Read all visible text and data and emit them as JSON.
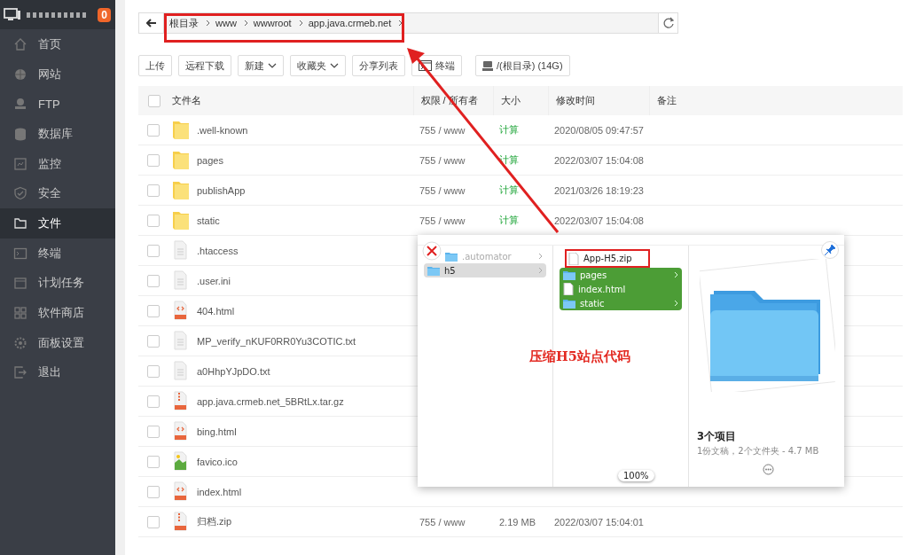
{
  "sidebar": {
    "badge": "0",
    "items": [
      {
        "label": "首页",
        "selected": false
      },
      {
        "label": "网站",
        "selected": false
      },
      {
        "label": "FTP",
        "selected": false
      },
      {
        "label": "数据库",
        "selected": false
      },
      {
        "label": "监控",
        "selected": false
      },
      {
        "label": "安全",
        "selected": false
      },
      {
        "label": "文件",
        "selected": true
      },
      {
        "label": "终端",
        "selected": false
      },
      {
        "label": "计划任务",
        "selected": false
      },
      {
        "label": "软件商店",
        "selected": false
      },
      {
        "label": "面板设置",
        "selected": false
      },
      {
        "label": "退出",
        "selected": false
      }
    ]
  },
  "breadcrumb": [
    "根目录",
    "www",
    "wwwroot",
    "app.java.crmeb.net"
  ],
  "toolbar": [
    {
      "label": "上传",
      "kind": "plain"
    },
    {
      "label": "远程下载",
      "kind": "plain"
    },
    {
      "label": "新建",
      "kind": "dropdown"
    },
    {
      "label": "收藏夹",
      "kind": "dropdown"
    },
    {
      "label": "分享列表",
      "kind": "plain"
    },
    {
      "label": "终端",
      "kind": "terminal"
    },
    {
      "label": "/(根目录) (14G)",
      "kind": "disk"
    }
  ],
  "table": {
    "columns": [
      "文件名",
      "权限 / 所有者",
      "大小",
      "修改时间",
      "备注"
    ],
    "header_checked": false,
    "rows": [
      {
        "name": ".well-known",
        "kind": "folder",
        "checked": false,
        "permissions": "755 / www",
        "size": "计算",
        "size_link": true,
        "modified": "2020/08/05 09:47:57"
      },
      {
        "name": "pages",
        "kind": "folder",
        "checked": false,
        "permissions": "755 / www",
        "size": "计算",
        "size_link": true,
        "modified": "2022/03/07 15:04:08"
      },
      {
        "name": "publishApp",
        "kind": "folder",
        "checked": false,
        "permissions": "755 / www",
        "size": "计算",
        "size_link": true,
        "modified": "2021/03/26 18:19:23"
      },
      {
        "name": "static",
        "kind": "folder",
        "checked": false,
        "permissions": "755 / www",
        "size": "计算",
        "size_link": true,
        "modified": "2022/03/07 15:04:08"
      },
      {
        "name": ".htaccess",
        "kind": "text",
        "checked": false
      },
      {
        "name": ".user.ini",
        "kind": "text",
        "checked": false
      },
      {
        "name": "404.html",
        "kind": "html",
        "checked": false
      },
      {
        "name": "MP_verify_nKUF0RR0Yu3COTIC.txt",
        "kind": "text",
        "checked": false
      },
      {
        "name": "a0HhpYJpDO.txt",
        "kind": "text",
        "checked": false
      },
      {
        "name": "app.java.crmeb.net_5BRtLx.tar.gz",
        "kind": "archive",
        "checked": false
      },
      {
        "name": "bing.html",
        "kind": "html",
        "checked": false
      },
      {
        "name": "favico.ico",
        "kind": "image",
        "checked": false
      },
      {
        "name": "index.html",
        "kind": "html",
        "checked": false
      },
      {
        "name": "归档.zip",
        "kind": "archive",
        "checked": false,
        "permissions": "755 / www",
        "size": "2.19 MB",
        "size_link": false,
        "modified": "2022/03/07 15:04:01"
      }
    ]
  },
  "preview": {
    "columns": [
      [
        {
          "name": ".automator",
          "kind": "folder",
          "selected": false,
          "disabled": true,
          "highlighted": false
        },
        {
          "name": "h5",
          "kind": "folder",
          "selected": true,
          "disabled": false,
          "highlighted": false
        }
      ],
      [
        {
          "name": "App-H5.zip",
          "kind": "document",
          "selected": false,
          "disabled": false,
          "highlighted": true
        },
        {
          "name": "pages",
          "kind": "folder",
          "selected": true,
          "disabled": false,
          "highlighted": false
        },
        {
          "name": "index.html",
          "kind": "document",
          "selected": true,
          "disabled": false,
          "highlighted": false
        },
        {
          "name": "static",
          "kind": "folder",
          "selected": true,
          "disabled": false,
          "highlighted": false
        }
      ]
    ],
    "note": "压缩H5站点代码",
    "zoom": "100%",
    "info_title": "3个项目",
    "info_subtitle": "1份文稿，2个文件夹 - 4.7 MB"
  }
}
